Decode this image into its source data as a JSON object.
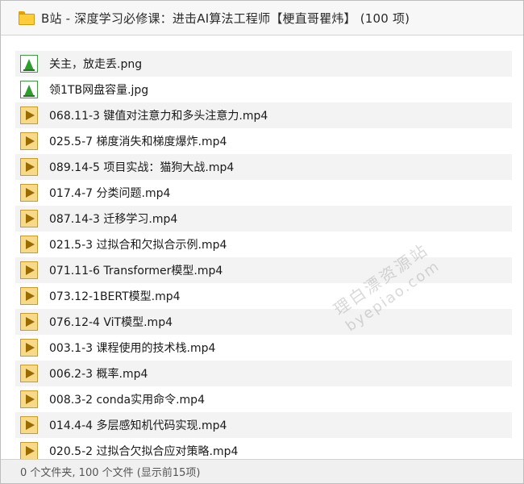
{
  "window": {
    "title": "B站 - 深度学习必修课：进击AI算法工程师【梗直哥瞿炜】 (100 项)"
  },
  "files": [
    {
      "name": "关主，放走丢.png",
      "type": "image"
    },
    {
      "name": "领1TB网盘容量.jpg",
      "type": "image"
    },
    {
      "name": "068.11-3 键值对注意力和多头注意力.mp4",
      "type": "video"
    },
    {
      "name": "025.5-7 梯度消失和梯度爆炸.mp4",
      "type": "video"
    },
    {
      "name": "089.14-5 项目实战：猫狗大战.mp4",
      "type": "video"
    },
    {
      "name": "017.4-7 分类问题.mp4",
      "type": "video"
    },
    {
      "name": "087.14-3 迁移学习.mp4",
      "type": "video"
    },
    {
      "name": "021.5-3 过拟合和欠拟合示例.mp4",
      "type": "video"
    },
    {
      "name": "071.11-6 Transformer模型.mp4",
      "type": "video"
    },
    {
      "name": "073.12-1BERT模型.mp4",
      "type": "video"
    },
    {
      "name": "076.12-4 ViT模型.mp4",
      "type": "video"
    },
    {
      "name": "003.1-3 课程使用的技术栈.mp4",
      "type": "video"
    },
    {
      "name": "006.2-3 概率.mp4",
      "type": "video"
    },
    {
      "name": "008.3-2 conda实用命令.mp4",
      "type": "video"
    },
    {
      "name": "014.4-4 多层感知机代码实现.mp4",
      "type": "video"
    },
    {
      "name": "020.5-2 过拟合欠拟合应对策略.mp4",
      "type": "video"
    }
  ],
  "status": {
    "text": "0 个文件夹, 100 个文件 (显示前15项)"
  },
  "watermark": {
    "line1": "理白漂资源站",
    "line2": "byepiao.com"
  },
  "colors": {
    "row_alt": "#f3f3f3",
    "video_icon": "#f7d98a",
    "image_icon": "#2e9e2e",
    "folder_icon": "#ffcd3c"
  }
}
